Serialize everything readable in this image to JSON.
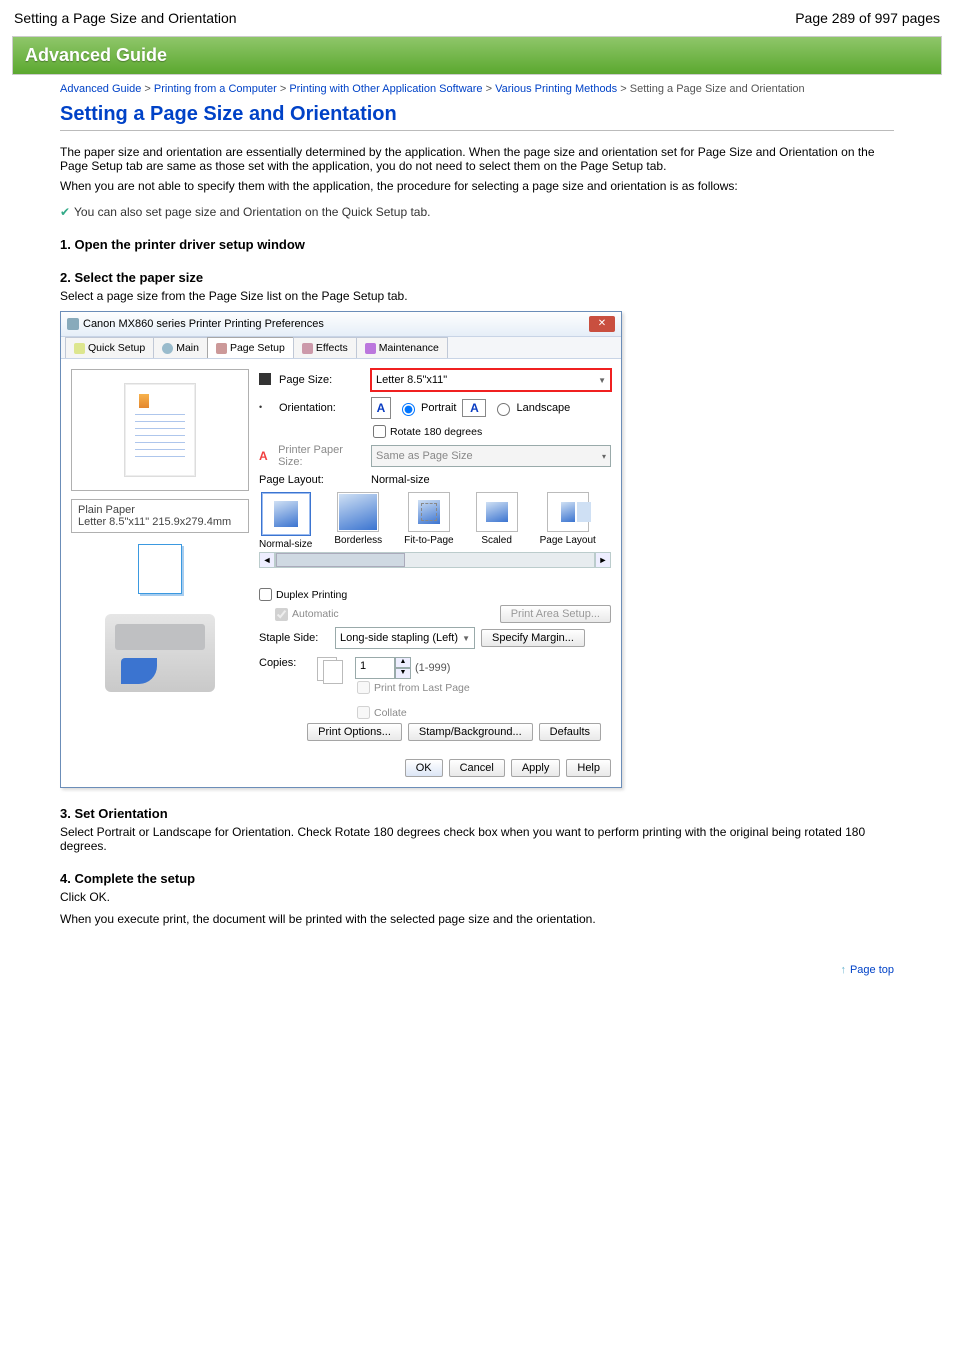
{
  "page_header": {
    "left": "Setting a Page Size and Orientation",
    "right": "Page 289 of 997 pages"
  },
  "banner": "Advanced Guide",
  "breadcrumb": {
    "items": [
      "Advanced Guide",
      "Printing from a Computer",
      "Printing with Other Application Software",
      "Various Printing Methods"
    ],
    "current": "Setting a Page Size and Orientation"
  },
  "title": "Setting a Page Size and Orientation",
  "intro": "The paper size and orientation are essentially determined by the application. When the page size and orientation set for Page Size and Orientation on the Page Setup tab are same as those set with the application, you do not need to select them on the Page Setup tab.",
  "note": "When you are not able to specify them with the application, the procedure for selecting a page size and orientation is as follows:",
  "quick_note": "You can also set page size and Orientation on the Quick Setup tab.",
  "step1": {
    "head": "1. Open the printer driver setup window",
    "link": "printer driver setup window"
  },
  "step2": {
    "head": "2. Select the paper size",
    "body": "Select a page size from the Page Size list on the Page Setup tab."
  },
  "step3": {
    "head": "3. Set Orientation",
    "body": "Select Portrait or Landscape for Orientation. Check Rotate 180 degrees check box when you want to perform printing with the original being rotated 180 degrees."
  },
  "step4": {
    "head": "4. Complete the setup",
    "body1": "Click OK.",
    "body2": "When you execute print, the document will be printed with the selected page size and the orientation."
  },
  "dialog": {
    "title": "Canon MX860 series Printer Printing Preferences",
    "tabs": [
      "Quick Setup",
      "Main",
      "Page Setup",
      "Effects",
      "Maintenance"
    ],
    "active_tab": 2,
    "page_size_label": "Page Size:",
    "page_size_value": "Letter 8.5\"x11\"",
    "orientation_label": "Orientation:",
    "portrait": "Portrait",
    "landscape": "Landscape",
    "rotate": "Rotate 180 degrees",
    "printer_paper_label": "Printer Paper Size:",
    "printer_paper_value": "Same as Page Size",
    "page_layout_label": "Page Layout:",
    "page_layout_value": "Normal-size",
    "layouts": [
      "Normal-size",
      "Borderless",
      "Fit-to-Page",
      "Scaled",
      "Page Layout"
    ],
    "paper_info_line1": "Plain Paper",
    "paper_info_line2": "Letter 8.5\"x11\" 215.9x279.4mm",
    "duplex": "Duplex Printing",
    "automatic": "Automatic",
    "print_area": "Print Area Setup...",
    "staple_label": "Staple Side:",
    "staple_value": "Long-side stapling (Left)",
    "specify_margin": "Specify Margin...",
    "copies_label": "Copies:",
    "copies_value": "1",
    "copies_range": "(1-999)",
    "print_last": "Print from Last Page",
    "collate": "Collate",
    "print_options": "Print Options...",
    "stamp_bg": "Stamp/Background...",
    "defaults": "Defaults",
    "ok": "OK",
    "cancel": "Cancel",
    "apply": "Apply",
    "help": "Help"
  },
  "back_top": "Page top"
}
